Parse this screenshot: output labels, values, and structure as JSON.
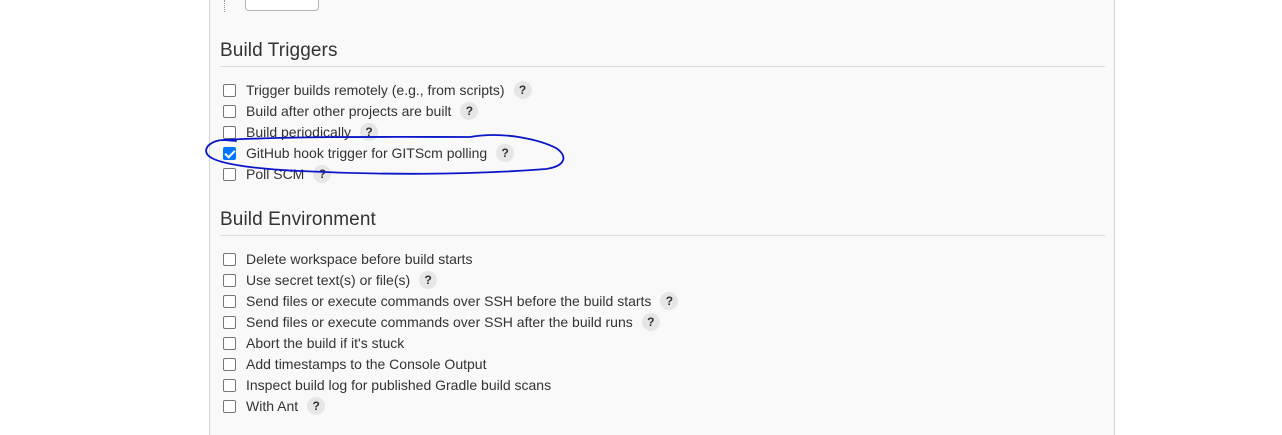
{
  "build_triggers": {
    "title": "Build Triggers",
    "options": [
      {
        "label": "Trigger builds remotely (e.g., from scripts)",
        "checked": false,
        "help": "?"
      },
      {
        "label": "Build after other projects are built",
        "checked": false,
        "help": "?"
      },
      {
        "label": "Build periodically",
        "checked": false,
        "help": "?"
      },
      {
        "label": "GitHub hook trigger for GITScm polling",
        "checked": true,
        "help": "?"
      },
      {
        "label": "Poll SCM",
        "checked": false,
        "help": "?"
      }
    ]
  },
  "build_environment": {
    "title": "Build Environment",
    "options": [
      {
        "label": "Delete workspace before build starts",
        "checked": false
      },
      {
        "label": "Use secret text(s) or file(s)",
        "checked": false,
        "help": "?"
      },
      {
        "label": "Send files or execute commands over SSH before the build starts",
        "checked": false,
        "help": "?"
      },
      {
        "label": "Send files or execute commands over SSH after the build runs",
        "checked": false,
        "help": "?"
      },
      {
        "label": "Abort the build if it's stuck",
        "checked": false
      },
      {
        "label": "Add timestamps to the Console Output",
        "checked": false
      },
      {
        "label": "Inspect build log for published Gradle build scans",
        "checked": false
      },
      {
        "label": "With Ant",
        "checked": false,
        "help": "?"
      }
    ]
  },
  "colors": {
    "checkbox_checked": "#0075ff",
    "annotation_stroke": "#0a17c8"
  }
}
